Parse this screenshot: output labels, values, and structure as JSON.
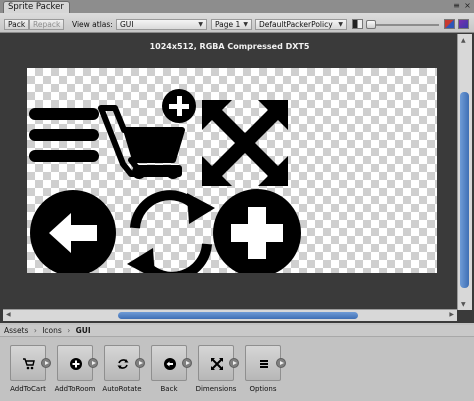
{
  "window": {
    "tab_title": "Sprite Packer"
  },
  "toolbar": {
    "pack_label": "Pack",
    "repack_label": "Repack",
    "view_atlas_label": "View atlas:",
    "atlas_selected": "GUI",
    "page_selected": "Page 1",
    "policy_selected": "DefaultPackerPolicy"
  },
  "canvas": {
    "caption": "1024x512, RGBA Compressed DXT5"
  },
  "breadcrumb": {
    "items": [
      "Assets",
      "Icons",
      "GUI"
    ],
    "separator": "›"
  },
  "assets": [
    {
      "label": "AddToCart",
      "icon": "add-to-cart-icon"
    },
    {
      "label": "AddToRoom",
      "icon": "add-to-room-icon"
    },
    {
      "label": "AutoRotate",
      "icon": "auto-rotate-icon"
    },
    {
      "label": "Back",
      "icon": "back-icon"
    },
    {
      "label": "Dimensions",
      "icon": "dimensions-icon"
    },
    {
      "label": "Options",
      "icon": "options-icon"
    }
  ],
  "colors": {
    "window_bg": "#3a3a3a",
    "scroll_thumb": "#4a7bc2",
    "panel_bg": "#c2c2c2"
  }
}
